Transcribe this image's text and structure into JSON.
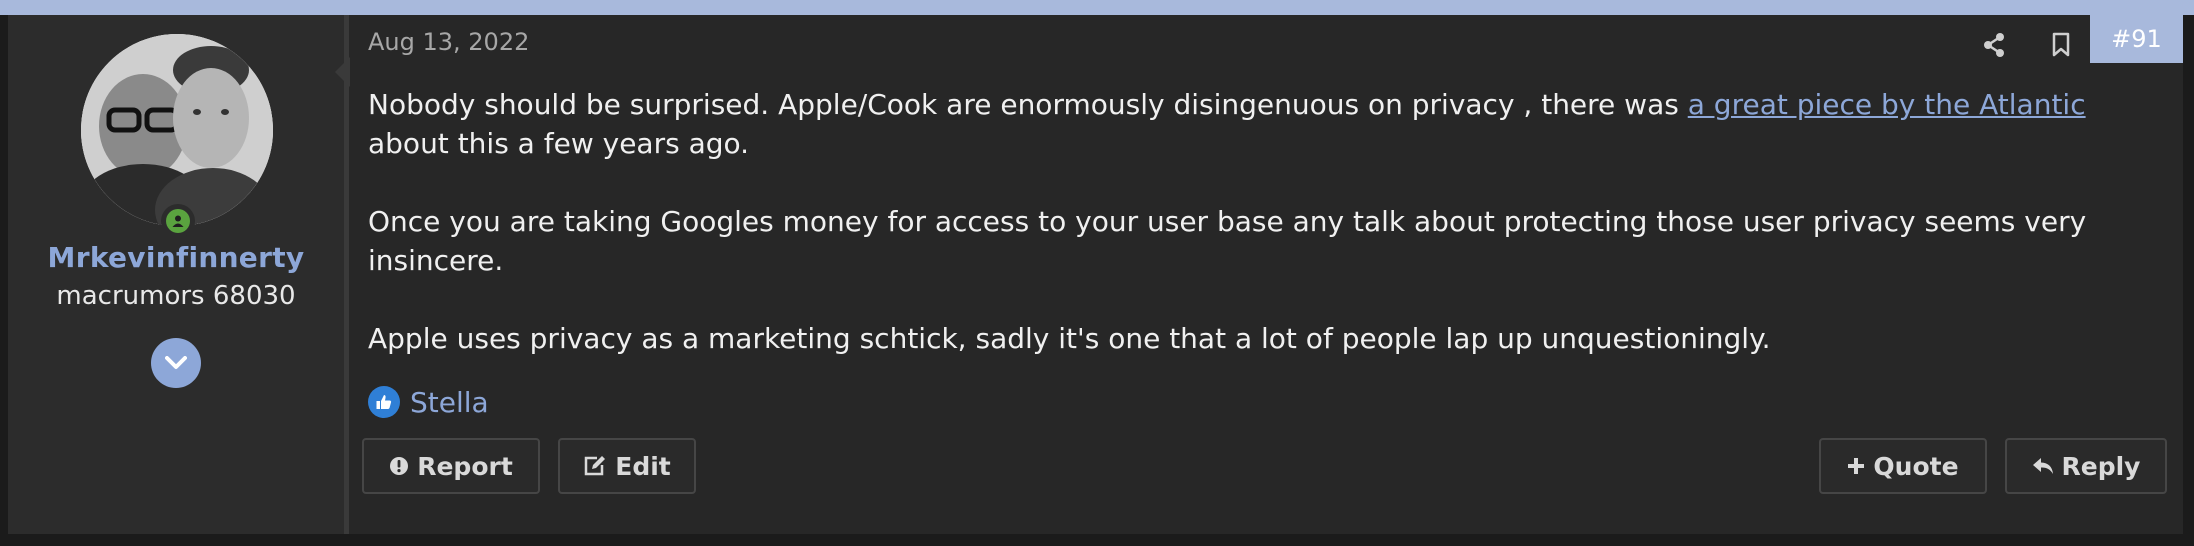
{
  "post": {
    "date": "Aug 13, 2022",
    "number": "#91",
    "body": {
      "p1_before_link": "Nobody should be surprised. Apple/Cook are enormously disingenuous on privacy , there was ",
      "p1_link": "a great piece by the Atlantic",
      "p1_after_link": " about this a few years ago.",
      "p2": "Once you are taking Googles money for access to your user base any talk about protecting those user privacy seems very insincere.",
      "p3": "Apple uses privacy as a marketing schtick, sadly it's one that a lot of people lap up unquestioningly."
    },
    "likes": {
      "names": "Stella",
      "icon": "thumbs-up-icon"
    }
  },
  "user": {
    "name": "Mrkevinfinnerty",
    "title": "macrumors 68030",
    "status": "online"
  },
  "actions": {
    "report_label": "Report",
    "edit_label": "Edit",
    "quote_label": "Quote",
    "reply_label": "Reply"
  },
  "icons": [
    "share-icon",
    "bookmark-icon",
    "chevron-down-icon",
    "exclamation-circle-icon",
    "edit-icon",
    "plus-icon",
    "reply-icon",
    "user-icon"
  ],
  "colors": {
    "accent": "#a8b9dc",
    "link": "#8da7d8",
    "background": "#272727",
    "online": "#5aa33f",
    "like": "#2f7fd6"
  }
}
